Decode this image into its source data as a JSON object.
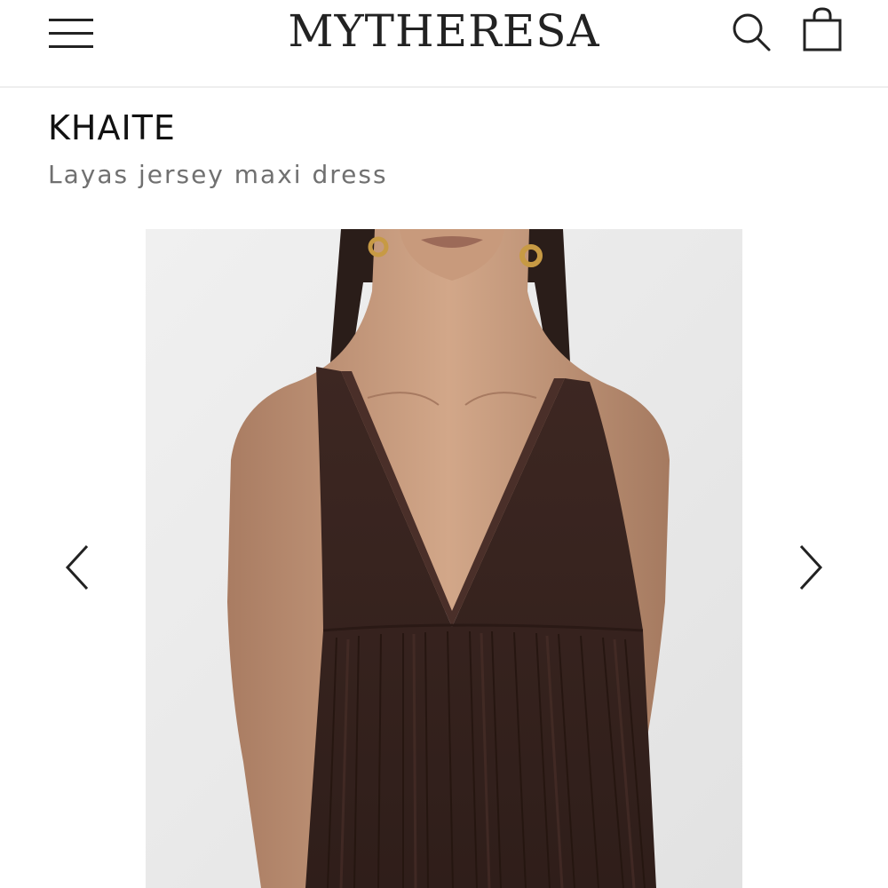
{
  "header": {
    "logo": "MYTHERESA",
    "icons": {
      "menu": "menu-icon",
      "search": "search-icon",
      "bag": "shopping-bag-icon"
    }
  },
  "product": {
    "brand": "KHAITE",
    "name": "Layas jersey maxi dress",
    "image_description": "Model wearing a brown sleeveless deep V-neck jersey dress with gathered skirt and gold chain earrings",
    "dress_color": "#3a2520"
  },
  "gallery": {
    "prev_icon": "chevron-left-icon",
    "next_icon": "chevron-right-icon"
  },
  "colors": {
    "text_primary": "#111111",
    "text_secondary": "#707070",
    "image_background": "#ececec",
    "divider": "#eeeeee"
  }
}
